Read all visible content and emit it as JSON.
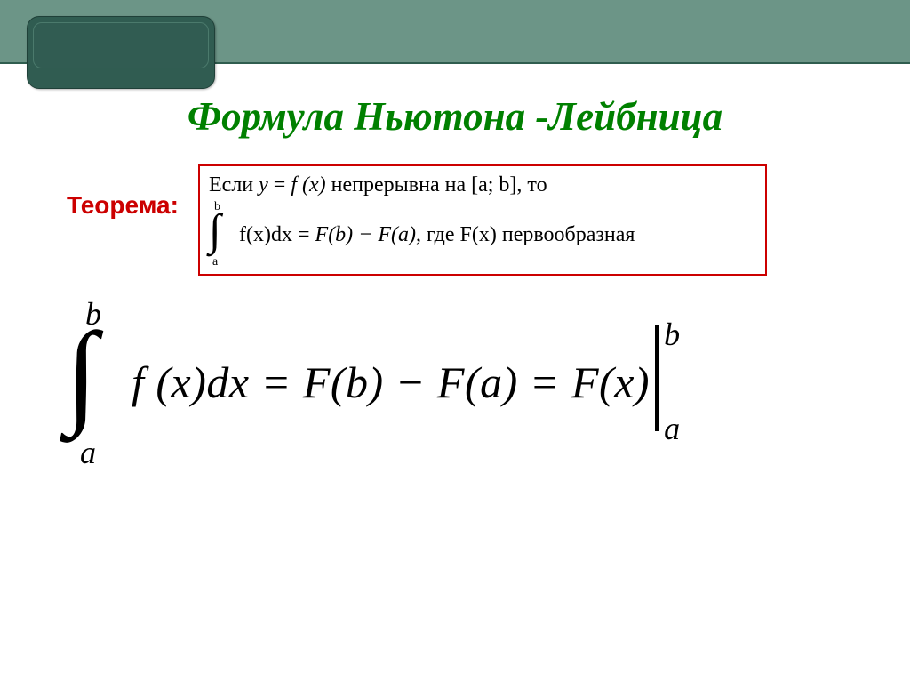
{
  "title": "Формула Ньютона -Лейбница",
  "theorem_label": "Теорема:",
  "box": {
    "line1_prefix": "Если ",
    "line1_eq_lhs": "y",
    "line1_eq_eq": " = ",
    "line1_eq_rhs": "f (x)",
    "line1_mid": " непрерывна на  ",
    "line1_interval": "[a; b]",
    "line1_suffix": ", то",
    "int_upper": "b",
    "int_lower": "a",
    "line2_integrand": "f(x)dx",
    "line2_eq": "  =  ",
    "line2_rhs1": "F(b) − F(a)",
    "line2_where": ", где ",
    "line2_Fx": "F(x)",
    "line2_antider": "  первообразная"
  },
  "formula": {
    "int_upper": "b",
    "int_lower": "a",
    "lhs": "f (x)dx",
    "eq1": " = ",
    "mid": "F(b) − F(a)",
    "eq2": " = ",
    "rhs": "F(x)",
    "eval_upper": "b",
    "eval_lower": "a"
  }
}
